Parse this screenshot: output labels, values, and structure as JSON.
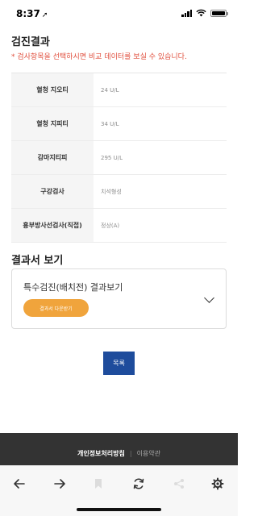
{
  "status_bar": {
    "time": "8:37",
    "location_glyph": "➚",
    "icons": [
      "signal-icon",
      "wifi-icon",
      "battery-icon"
    ]
  },
  "exam_results": {
    "title": "검진결과",
    "notice": "* 검사항목을 선택하시면 비교 데이터를 보실 수 있습니다.",
    "rows": [
      {
        "label": "혈청 지오티",
        "value": "24 U/L"
      },
      {
        "label": "혈청 지피티",
        "value": "34 U/L"
      },
      {
        "label": "감마지티피",
        "value": "295 U/L"
      },
      {
        "label": "구강검사",
        "value": "치석형성"
      },
      {
        "label": "흉부방사선검사(직접)",
        "value": "정상(A)"
      }
    ]
  },
  "report": {
    "title": "결과서 보기",
    "card_title": "특수검진(배치전) 결과보기",
    "download_label": "결과서 다운받기"
  },
  "list_button": "목록",
  "footer": {
    "privacy": "개인정보처리방침",
    "separator": "|",
    "terms": "이용약관"
  },
  "browser_toolbar": {
    "icons": [
      "back-arrow-icon",
      "forward-arrow-icon",
      "bookmark-icon",
      "refresh-icon",
      "share-icon",
      "settings-gear-icon"
    ]
  },
  "colors": {
    "notice": "#e04e3c",
    "download_button": "#f0a43c",
    "list_button": "#1e4c9c",
    "footer": "#333333"
  }
}
